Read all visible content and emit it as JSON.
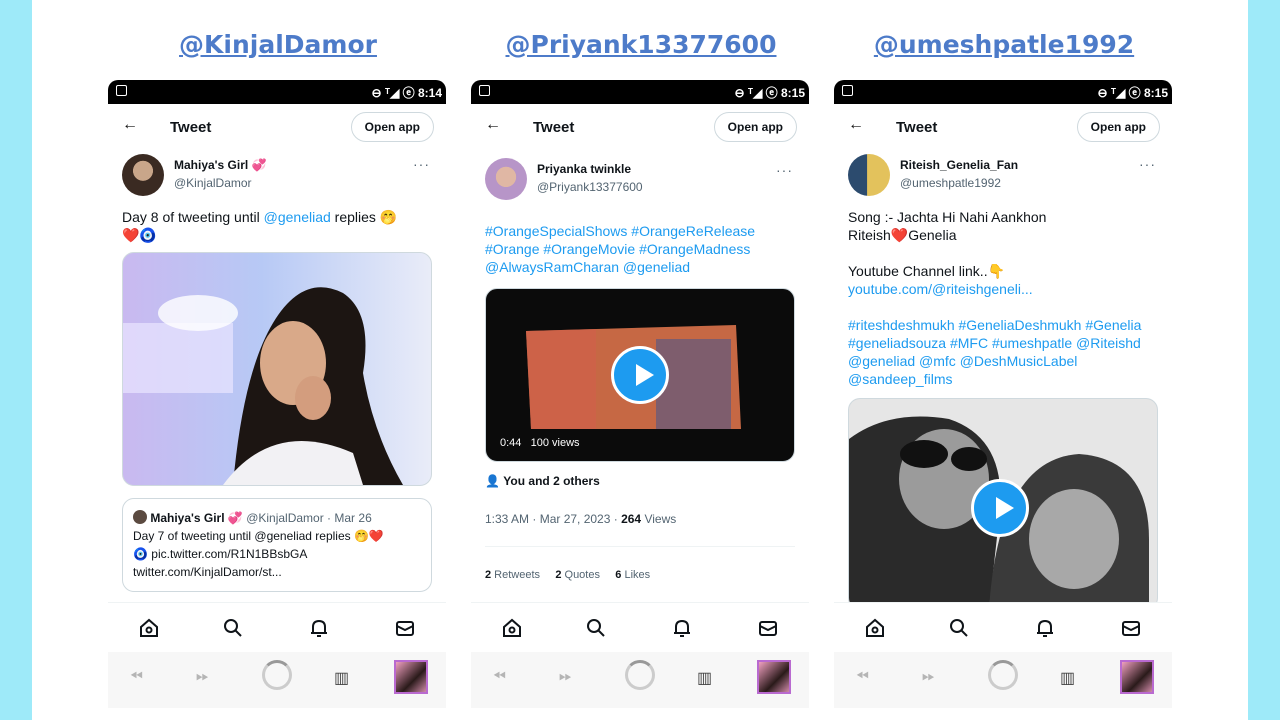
{
  "columns": [
    {
      "heading": "@KinjalDamor",
      "status_time": "8:14",
      "header": {
        "title": "Tweet",
        "open_app": "Open app"
      },
      "author": {
        "name": "Mahiya's Girl 💞",
        "handle": "@KinjalDamor"
      },
      "text_plain": "Day 8 of tweeting until ",
      "text_link": "@geneliad",
      "text_tail": " replies 🤭",
      "text_line2": "❤️🧿",
      "quote": {
        "name": "Mahiya's Girl 💞",
        "handle_date": "@KinjalDamor · Mar 26",
        "line1": "Day 7 of tweeting until @geneliad replies 🤭❤️",
        "line2": "🧿 pic.twitter.com/R1N1BBsbGA",
        "line3": "twitter.com/KinjalDamor/st..."
      }
    },
    {
      "heading": "@Priyank13377600",
      "status_time": "8:15",
      "header": {
        "title": "Tweet",
        "open_app": "Open app"
      },
      "author": {
        "name": "Priyanka twinkle",
        "handle": "@Priyank13377600"
      },
      "hashtags": "#OrangeSpecialShows #OrangeReRelease #Orange #OrangeMovie #OrangeMadness @AlwaysRamCharan @geneliad",
      "video": {
        "duration": "0:44",
        "views": "100 views"
      },
      "liked_by": "You and 2 others",
      "timestamp": "1:33 AM · Mar 27, 2023 · ",
      "views_count": "264",
      "views_label": " Views",
      "retweets": "2",
      "retweets_label": " Retweets",
      "quotes": "2",
      "quotes_label": " Quotes",
      "likes": "6",
      "likes_label": " Likes"
    },
    {
      "heading": "@umeshpatle1992",
      "status_time": "8:15",
      "header": {
        "title": "Tweet",
        "open_app": "Open app"
      },
      "author": {
        "name": "Riteish_Genelia_Fan",
        "handle": "@umeshpatle1992"
      },
      "song_line1": "Song :- Jachta Hi Nahi Aankhon",
      "song_line2": "Riteish❤️Genelia",
      "yt_label": "Youtube Channel link..👇",
      "yt_link": "youtube.com/@riteishgeneli...",
      "hashtags": "#riteshdeshmukh #GeneliaDeshmukh #Genelia #geneliadsouza #MFC #umeshpatle @Riteishd @geneliad @mfc @DeshMusicLabel @sandeep_films"
    }
  ],
  "colors": {
    "background": "#9eeaf9",
    "heading": "#4d7bc9",
    "link": "#1d9bf0",
    "retweet_green": "#00ba7c"
  },
  "icons": [
    "back-arrow-icon",
    "more-icon",
    "play-icon",
    "home-icon",
    "search-icon",
    "bell-icon",
    "mail-icon",
    "rewind-icon",
    "fast-forward-icon",
    "spinner-icon",
    "book-icon",
    "reply-icon",
    "retweet-icon",
    "like-icon",
    "bookmark-icon",
    "share-icon",
    "person-icon"
  ]
}
